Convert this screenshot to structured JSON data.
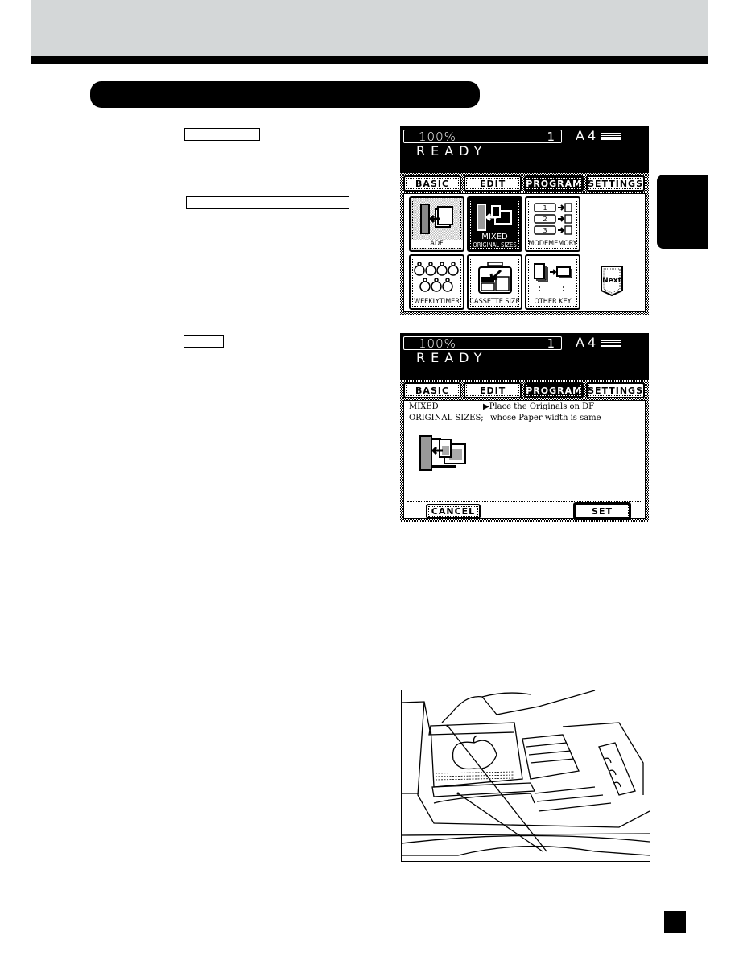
{
  "document": {
    "header_color": "#d4d7d8",
    "accent_color": "#000000"
  },
  "instructions": {
    "key_boxes": [
      "",
      "",
      ""
    ],
    "underline_text": ""
  },
  "screen1": {
    "zoom": "100%",
    "copies": "1",
    "paper_size": "A4",
    "status": "READY",
    "tabs": [
      {
        "label": "BASIC",
        "active": false
      },
      {
        "label": "EDIT",
        "active": false
      },
      {
        "label": "PROGRAM",
        "active": true
      },
      {
        "label": "SETTINGS",
        "active": false
      }
    ],
    "tiles": [
      {
        "label": "ADF",
        "icon": "adf-icon"
      },
      {
        "label_line1": "MIXED",
        "label_line2": "ORIGINAL SIZES",
        "icon": "mixed-original-sizes-icon",
        "selected": true
      },
      {
        "label": "MODEMEMORY",
        "icon": "mode-memory-icon",
        "memory_slots": [
          "1",
          "2",
          "3"
        ]
      },
      {
        "label": "WEEKLYTIMER",
        "icon": "weekly-timer-icon"
      },
      {
        "label": "CASSETTE SIZE",
        "icon": "cassette-size-icon"
      },
      {
        "label": "OTHER KEY",
        "icon": "other-key-icon"
      }
    ],
    "next_label": "Next"
  },
  "screen2": {
    "zoom": "100%",
    "copies": "1",
    "paper_size": "A4",
    "status": "READY",
    "tabs": [
      {
        "label": "BASIC",
        "active": false
      },
      {
        "label": "EDIT",
        "active": false
      },
      {
        "label": "PROGRAM",
        "active": true
      },
      {
        "label": "SETTINGS",
        "active": false
      }
    ],
    "title_line1": "MIXED",
    "title_line2": "ORIGINAL SIZES;",
    "message_line1": "▶Place the Originals on DF",
    "message_line2": "whose Paper width is same",
    "cancel_label": "CANCEL",
    "set_label": "SET"
  },
  "illustration": {
    "subject": "document-feeder-loading-originals"
  }
}
